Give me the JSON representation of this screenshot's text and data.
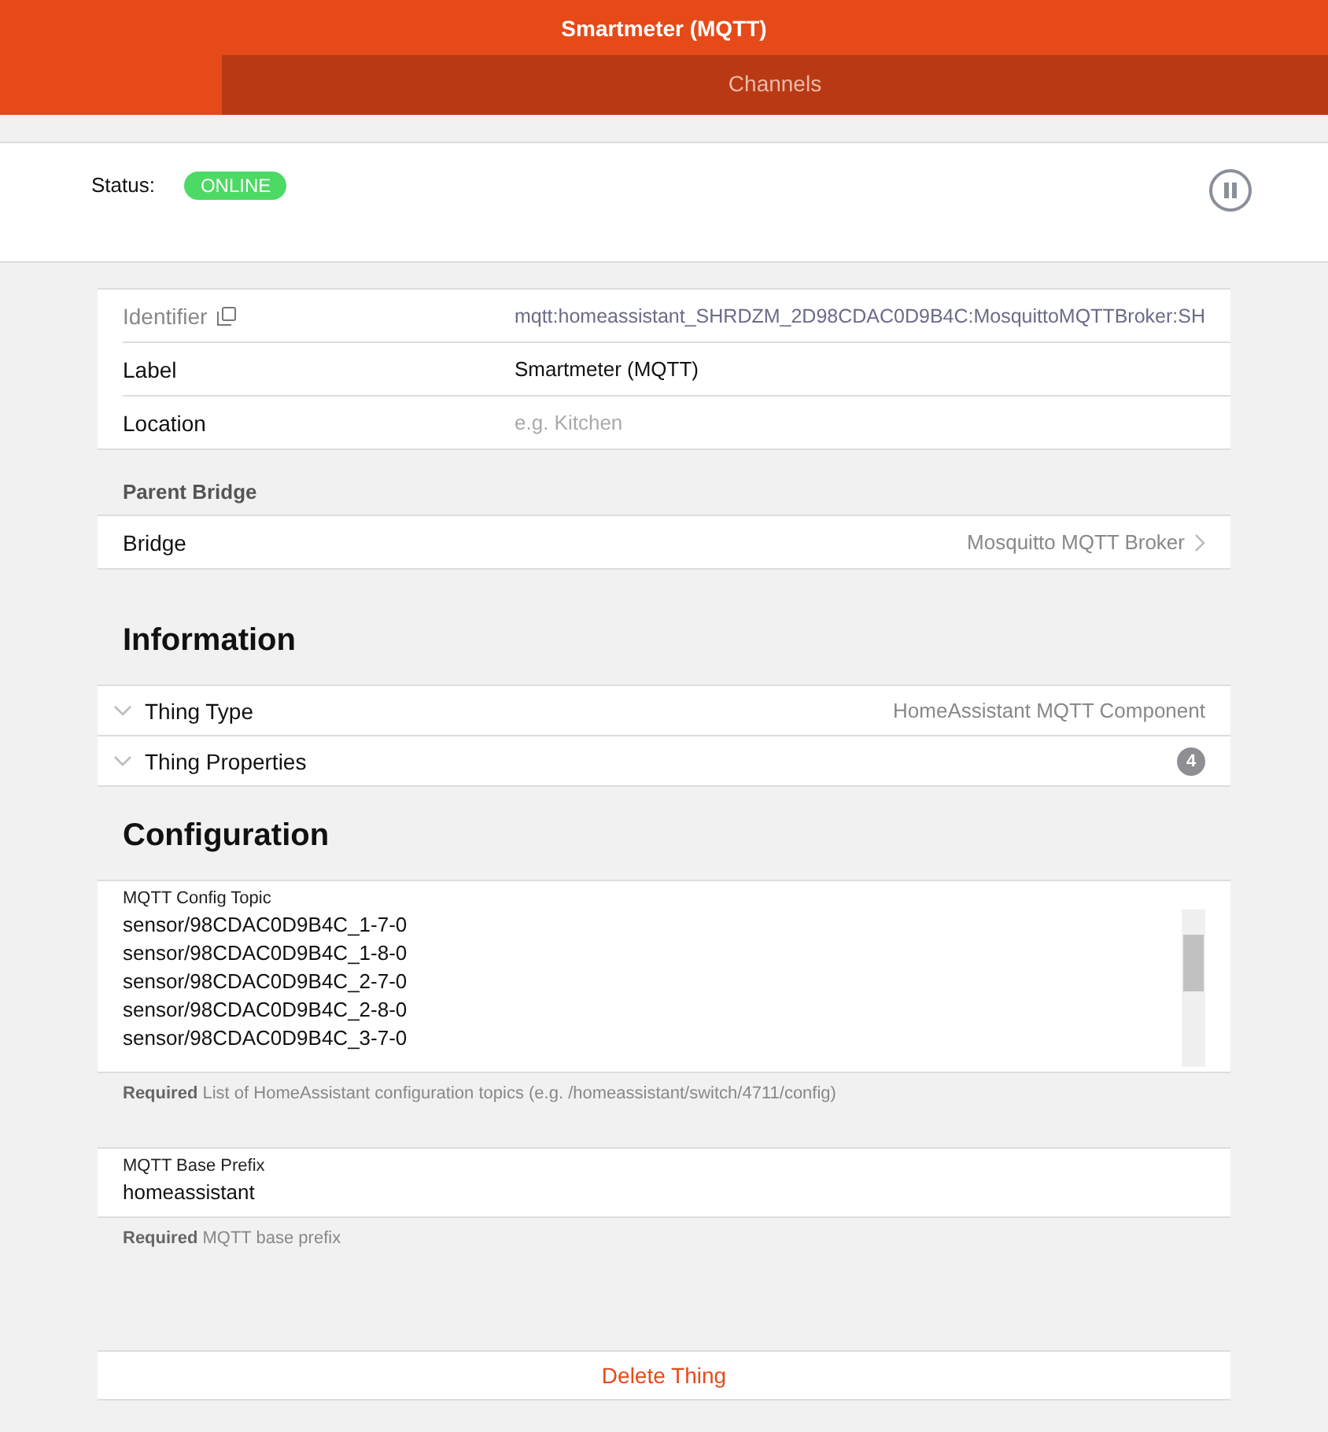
{
  "header": {
    "title": "Smartmeter (MQTT)"
  },
  "tabs": [
    {
      "label": "Channels",
      "selected": false
    }
  ],
  "status": {
    "label": "Status:",
    "value": "ONLINE",
    "online": true
  },
  "details": [
    {
      "kind": "identifier",
      "label": "Identifier",
      "value": "mqtt:homeassistant_SHRDZM_2D98CDAC0D9B4C:MosquittoMQTTBroker:SH"
    },
    {
      "kind": "input",
      "label": "Label",
      "value": "Smartmeter (MQTT)"
    },
    {
      "kind": "input",
      "label": "Location",
      "placeholder": "e.g. Kitchen"
    }
  ],
  "parent_bridge": {
    "heading": "Parent Bridge",
    "label": "Bridge",
    "value": "Mosquitto MQTT Broker"
  },
  "information": {
    "heading": "Information",
    "items": [
      {
        "label": "Thing Type",
        "value": "HomeAssistant MQTT Component",
        "expanded": false
      },
      {
        "label": "Thing Properties",
        "count": "4",
        "expanded": false
      }
    ]
  },
  "configuration": {
    "heading": "Configuration",
    "params": [
      {
        "kind": "list",
        "label": "MQTT Config Topic",
        "lines": [
          "sensor/98CDAC0D9B4C_1-7-0",
          "sensor/98CDAC0D9B4C_1-8-0",
          "sensor/98CDAC0D9B4C_2-7-0",
          "sensor/98CDAC0D9B4C_2-8-0",
          "sensor/98CDAC0D9B4C_3-7-0"
        ],
        "help": "**Required** List of HomeAssistant configuration topics (e.g. /homeassistant/switch/4711/config)"
      },
      {
        "kind": "text",
        "label": "MQTT Base Prefix",
        "value": "homeassistant",
        "help": "**Required** MQTT base prefix"
      }
    ]
  },
  "delete_button": "Delete Thing"
}
